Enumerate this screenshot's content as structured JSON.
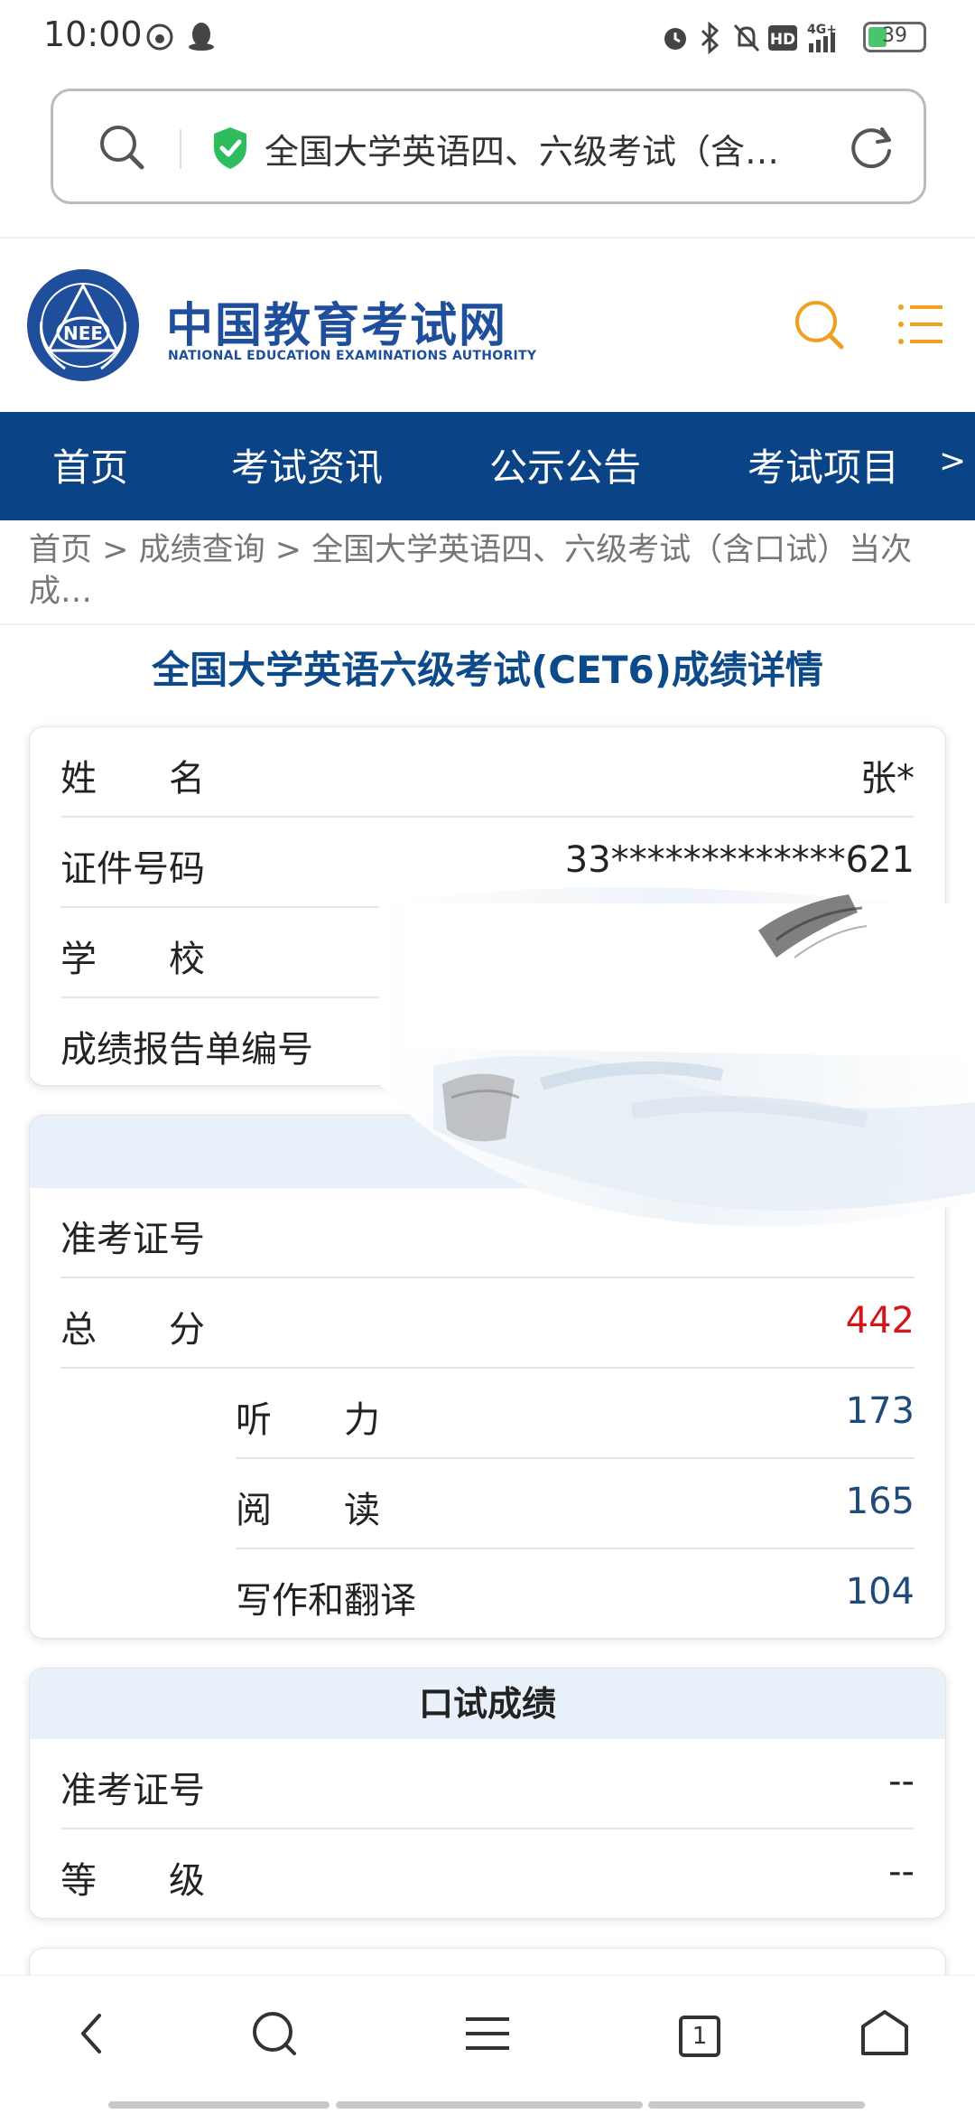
{
  "status_bar": {
    "time": "10:00",
    "battery": "39"
  },
  "url_bar": {
    "title": "全国大学英语四、六级考试（含…"
  },
  "site": {
    "name_cn": "中国教育考试网",
    "name_en": "NATIONAL EDUCATION EXAMINATIONS AUTHORITY",
    "emblem_text": "NEE"
  },
  "nav": {
    "items": [
      "首页",
      "考试资讯",
      "公示公告",
      "考试项目"
    ],
    "more": ">"
  },
  "breadcrumb": "首页 > 成绩查询 > 全国大学英语四、六级考试（含口试）当次成…",
  "page_title": "全国大学英语六级考试(CET6)成绩详情",
  "personal": {
    "name_label": "姓　　名",
    "name_value": "张*",
    "id_label": "证件号码",
    "id_value": "33*************621",
    "school_label": "学　　校",
    "report_label": "成绩报告单编号"
  },
  "written": {
    "ticket_label": "准考证号",
    "total_label": "总　　分",
    "total_value": "442",
    "listening_label": "听　　力",
    "listening_value": "173",
    "reading_label": "阅　　读",
    "reading_value": "165",
    "writing_label": "写作和翻译",
    "writing_value": "104"
  },
  "oral": {
    "header": "口试成绩",
    "ticket_label": "准考证号",
    "ticket_value": "--",
    "grade_label": "等　　级",
    "grade_value": "--"
  },
  "bottom_nav": {
    "tab_count": "1"
  },
  "colors": {
    "nav_bg": "#0b4486",
    "brand_blue": "#1f4e9c",
    "total_red": "#d0171c",
    "accent_orange": "#f0a020"
  }
}
